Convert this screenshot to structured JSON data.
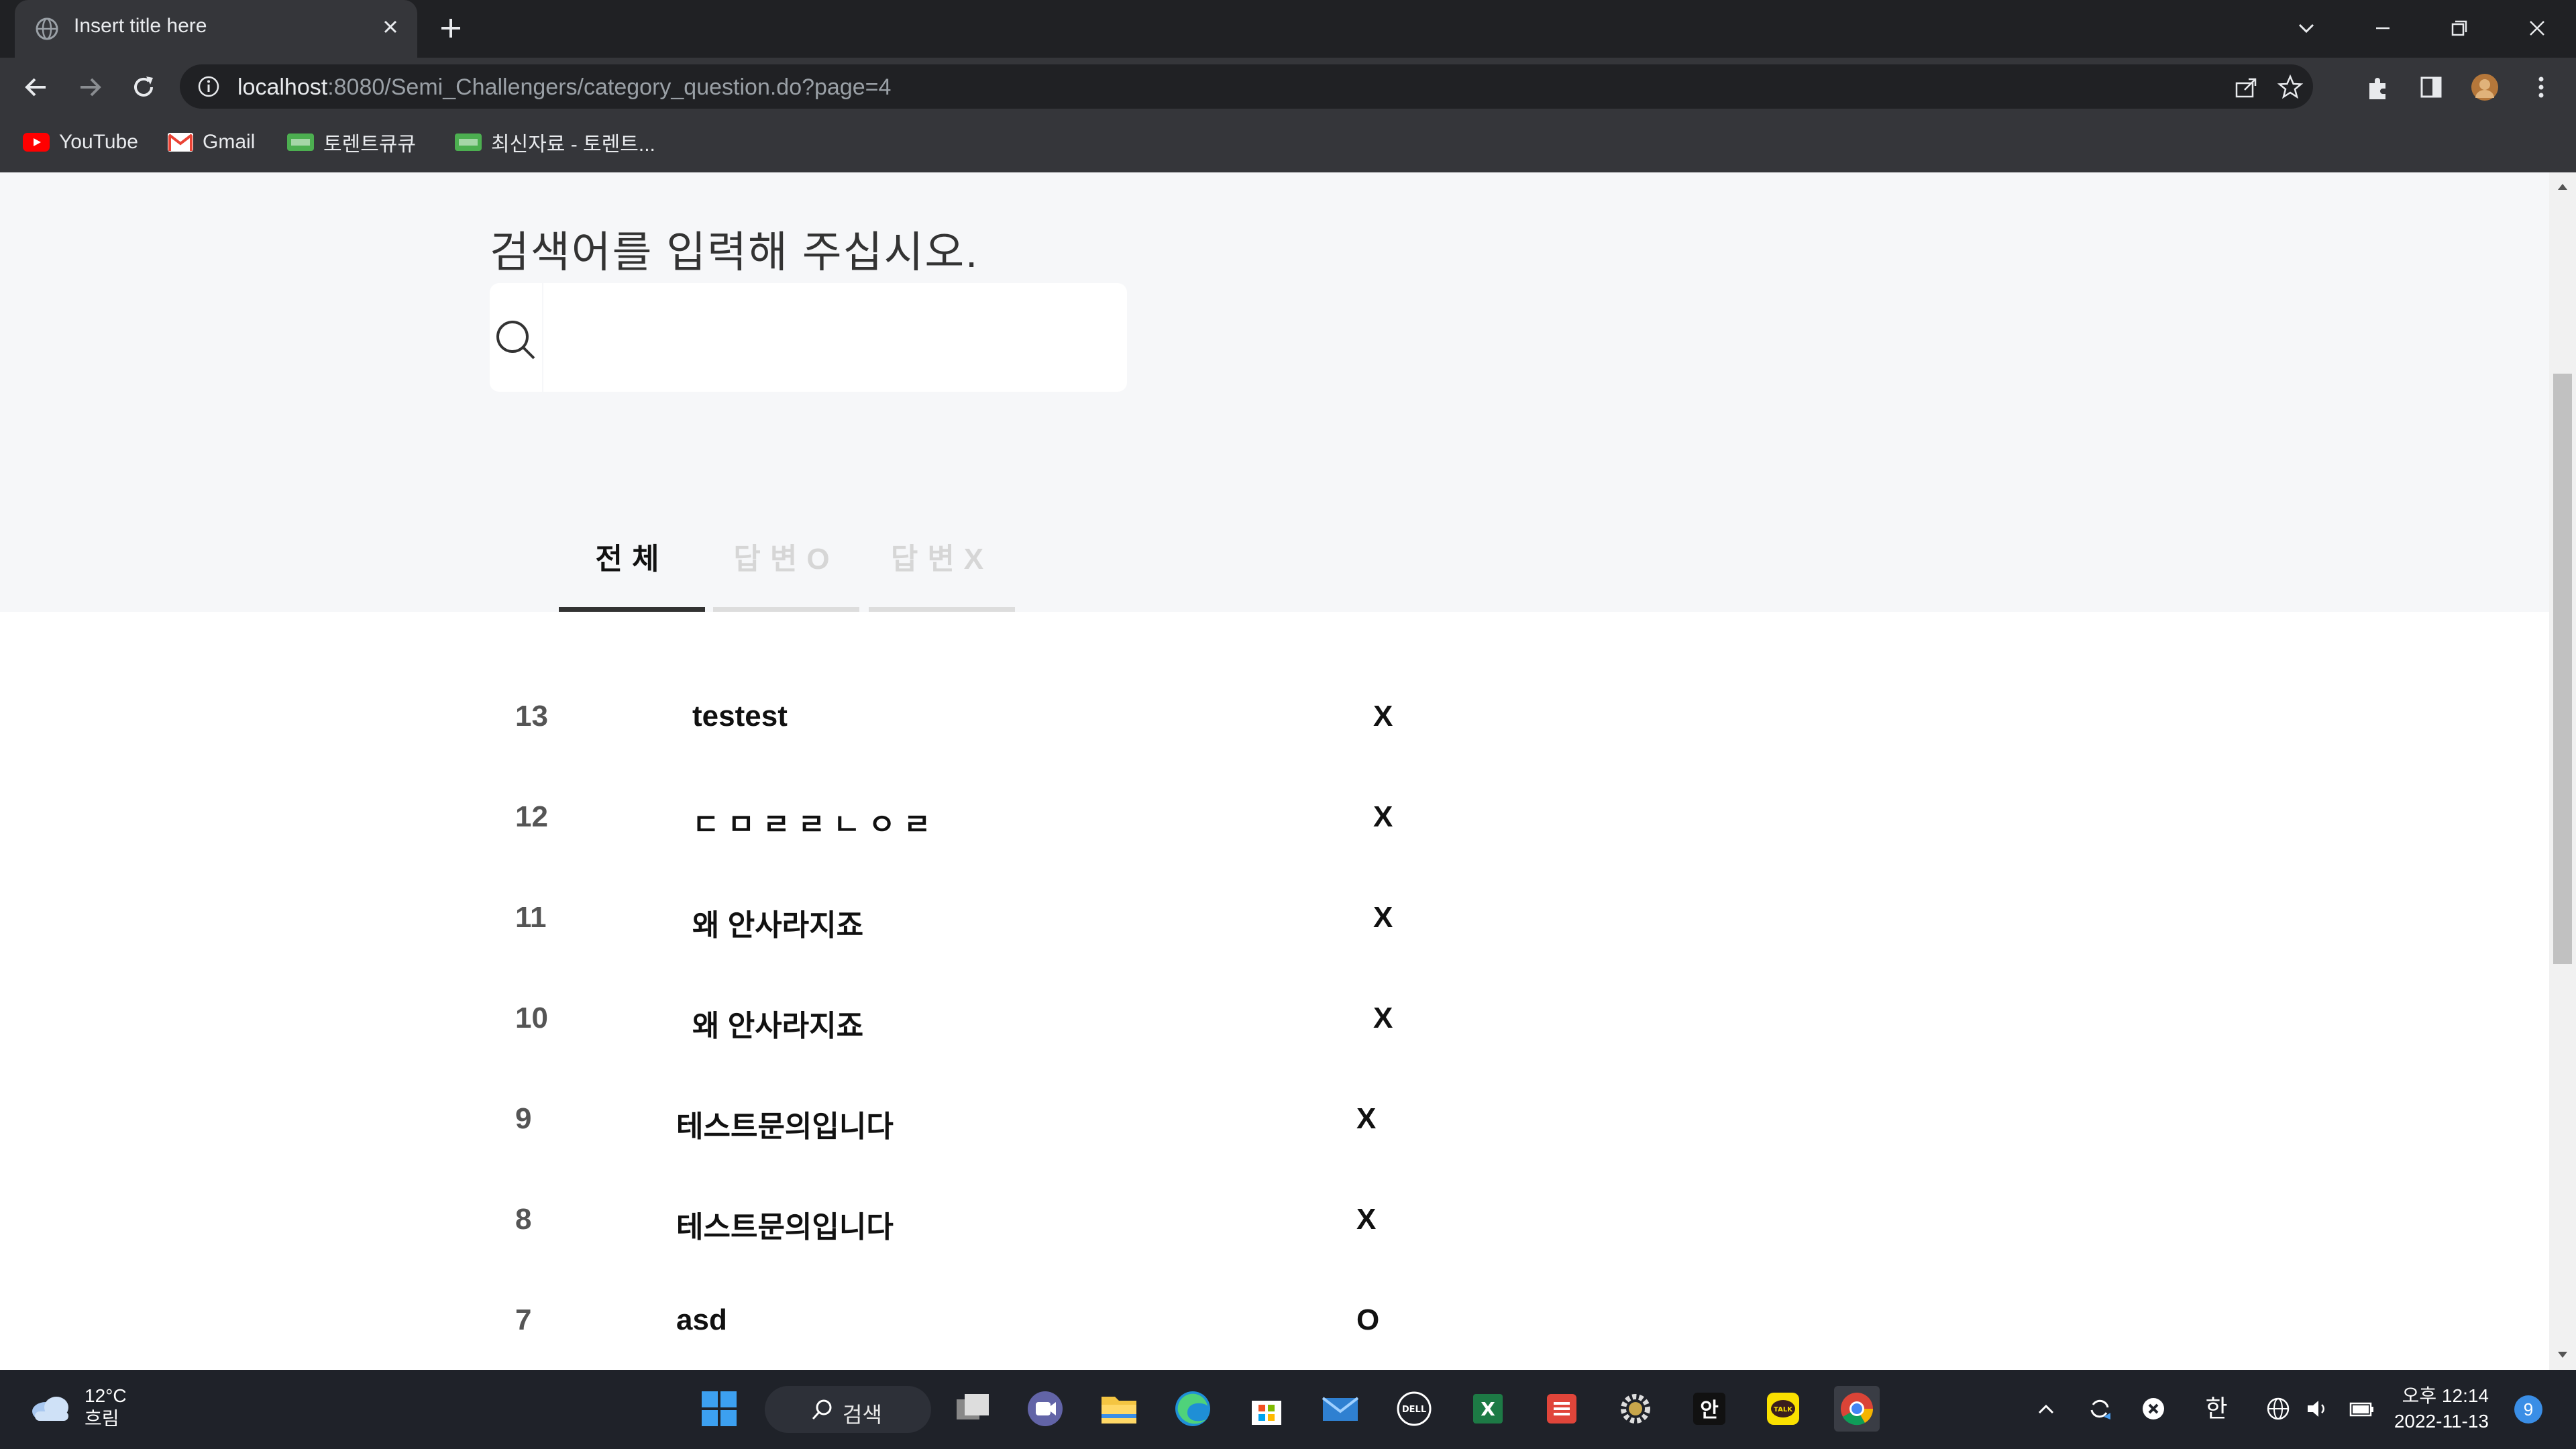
{
  "browser": {
    "tab_title": "Insert title here",
    "url_host": "localhost",
    "url_rest": ":8080/Semi_Challengers/category_question.do?page=4",
    "bookmarks": [
      {
        "label": "YouTube",
        "icon": "youtube-icon"
      },
      {
        "label": "Gmail",
        "icon": "gmail-icon"
      },
      {
        "label": "토렌트큐큐",
        "icon": "torrent-icon"
      },
      {
        "label": "최신자료 - 토렌트...",
        "icon": "torrent-icon"
      }
    ]
  },
  "page": {
    "search_heading": "검색어를 입력해 주십시오.",
    "search_placeholder": "",
    "tabs": [
      {
        "label": "전체",
        "active": true
      },
      {
        "label": "답변O",
        "active": false
      },
      {
        "label": "답변X",
        "active": false
      }
    ],
    "rows": [
      {
        "num": "13",
        "title": "testest",
        "answer": "X"
      },
      {
        "num": "12",
        "title": "ㄷㅁㄹㄹㄴㅇㄹ",
        "answer": "X"
      },
      {
        "num": "11",
        "title": "왜 안사라지죠",
        "answer": "X"
      },
      {
        "num": "10",
        "title": "왜 안사라지죠",
        "answer": "X"
      },
      {
        "num": "9",
        "title": "테스트문의입니다",
        "answer": "X"
      },
      {
        "num": "8",
        "title": "테스트문의입니다",
        "answer": "X"
      },
      {
        "num": "7",
        "title": "asd",
        "answer": "O"
      }
    ]
  },
  "taskbar": {
    "weather_temp": "12°C",
    "weather_desc": "흐림",
    "search_label": "검색",
    "ime": "한",
    "time": "오후 12:14",
    "date": "2022-11-13",
    "notifications": "9"
  },
  "colors": {
    "chrome_dark": "#202124",
    "toolbar": "#35363a",
    "hero_bg": "#f6f7f9",
    "tab_active_bar": "#333333",
    "tab_inactive_bar": "#dddddd"
  }
}
